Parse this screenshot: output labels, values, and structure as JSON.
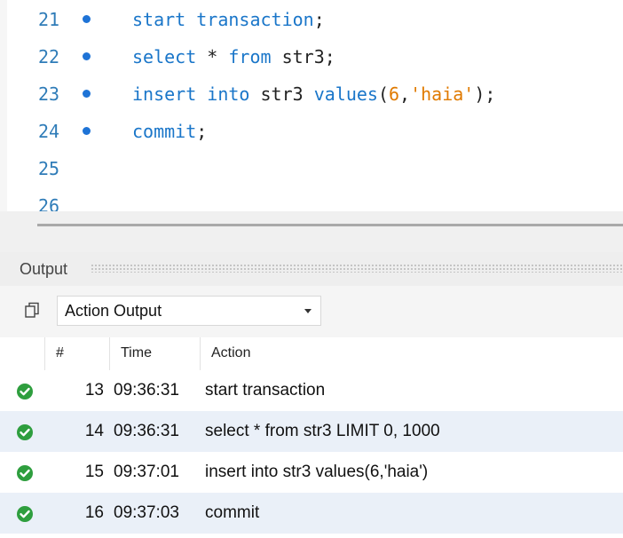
{
  "editor": {
    "lines": [
      {
        "number": "21",
        "has_dot": true,
        "tokens": [
          {
            "t": "start transaction",
            "c": "kw"
          },
          {
            "t": ";",
            "c": "plain"
          }
        ]
      },
      {
        "number": "22",
        "has_dot": true,
        "tokens": [
          {
            "t": "select",
            "c": "kw"
          },
          {
            "t": " * ",
            "c": "plain"
          },
          {
            "t": "from",
            "c": "kw"
          },
          {
            "t": " str3;",
            "c": "plain"
          }
        ]
      },
      {
        "number": "23",
        "has_dot": true,
        "tokens": [
          {
            "t": "insert into",
            "c": "kw"
          },
          {
            "t": " str3 ",
            "c": "plain"
          },
          {
            "t": "values",
            "c": "kw"
          },
          {
            "t": "(",
            "c": "plain"
          },
          {
            "t": "6",
            "c": "num"
          },
          {
            "t": ",",
            "c": "plain"
          },
          {
            "t": "'haia'",
            "c": "str"
          },
          {
            "t": ");",
            "c": "plain"
          }
        ]
      },
      {
        "number": "24",
        "has_dot": true,
        "tokens": [
          {
            "t": "commit",
            "c": "kw"
          },
          {
            "t": ";",
            "c": "plain"
          }
        ]
      },
      {
        "number": "25",
        "has_dot": false,
        "tokens": []
      },
      {
        "number": "26",
        "has_dot": false,
        "tokens": []
      }
    ]
  },
  "output": {
    "title": "Output",
    "selector_value": "Action Output",
    "columns": {
      "number": "#",
      "time": "Time",
      "action": "Action"
    },
    "rows": [
      {
        "number": "13",
        "time": "09:36:31",
        "action": "start transaction",
        "status": "success"
      },
      {
        "number": "14",
        "time": "09:36:31",
        "action": "select * from str3 LIMIT 0, 1000",
        "status": "success"
      },
      {
        "number": "15",
        "time": "09:37:01",
        "action": "insert into str3 values(6,'haia')",
        "status": "success"
      },
      {
        "number": "16",
        "time": "09:37:03",
        "action": "commit",
        "status": "success"
      }
    ]
  },
  "colors": {
    "success": "#2e9e3e",
    "keyword": "#1a76c9",
    "string": "#e07a00",
    "line_number": "#2f7cb8",
    "alt_row": "#eaf0f8"
  },
  "icons": {
    "status": "check-circle-icon",
    "toolbar": "copy-icon",
    "dropdown": "chevron-down-icon"
  }
}
